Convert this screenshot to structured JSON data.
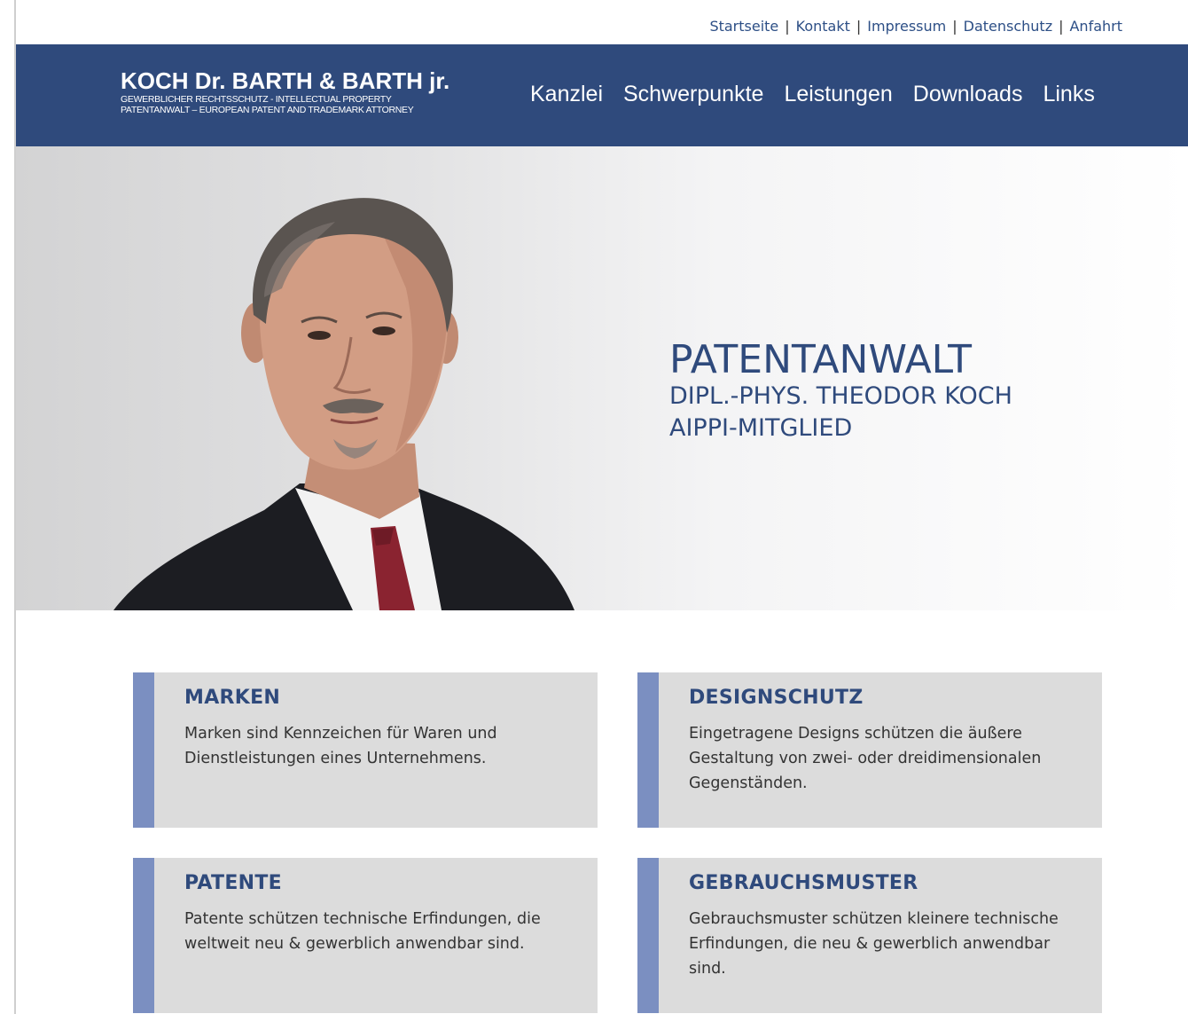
{
  "util_nav": {
    "items": [
      "Startseite",
      "Kontakt",
      "Impressum",
      "Datenschutz",
      "Anfahrt"
    ],
    "separator": "|"
  },
  "logo": {
    "title": "KOCH Dr. BARTH & BARTH jr.",
    "line1": "GEWERBLICHER RECHTSSCHUTZ - INTELLECTUAL PROPERTY",
    "line2": "PATENTANWALT – EUROPEAN PATENT AND TRADEMARK ATTORNEY"
  },
  "main_nav": {
    "items": [
      "Kanzlei",
      "Schwerpunkte",
      "Leistungen",
      "Downloads",
      "Links"
    ]
  },
  "hero": {
    "title": "PATENTANWALT",
    "subtitle": "DIPL.-PHYS. THEODOR KOCH",
    "membership": "AIPPI-MITGLIED"
  },
  "cards": [
    {
      "title": "MARKEN",
      "text": "Marken sind Kennzeichen für Waren und Dienstleistungen eines Unternehmens."
    },
    {
      "title": "DESIGNSCHUTZ",
      "text": "Eingetragene Designs schützen die äußere Gestaltung von zwei- oder dreidimensionalen Gegenständen."
    },
    {
      "title": "PATENTE",
      "text": "Patente schützen technische Erfindungen, die weltweit neu & gewerblich anwendbar sind."
    },
    {
      "title": "GEBRAUCHSMUSTER",
      "text": "Gebrauchsmuster schützen kleinere technische Erfindungen, die neu & gewerblich anwendbar sind."
    }
  ],
  "colors": {
    "brand_blue": "#2f4a7c",
    "card_accent": "#7b8fc1",
    "card_bg": "#dcdcdc"
  }
}
